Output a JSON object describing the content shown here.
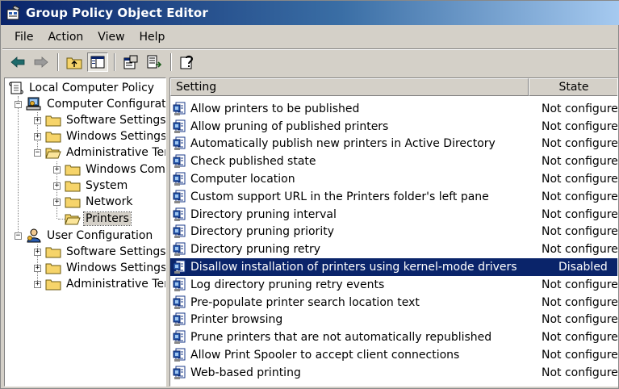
{
  "window": {
    "title": "Group Policy Object Editor"
  },
  "menu": [
    "File",
    "Action",
    "View",
    "Help"
  ],
  "toolbar": {
    "buttons": [
      "back-icon",
      "forward-icon",
      "up-folder-icon",
      "show-hide-tree-icon",
      "properties-icon",
      "export-list-icon",
      "help-icon"
    ]
  },
  "tree": {
    "root": "Local Computer Policy",
    "computer": "Computer Configuration",
    "software_settings": "Software Settings",
    "windows_settings": "Windows Settings",
    "administrative_templates": "Administrative Templates",
    "windows_components": "Windows Components",
    "system": "System",
    "network": "Network",
    "printers": "Printers",
    "user": "User Configuration",
    "user_software_settings": "Software Settings",
    "user_windows_settings": "Windows Settings",
    "user_administrative_templates": "Administrative Templates"
  },
  "list": {
    "columns": {
      "setting": "Setting",
      "state": "State"
    },
    "rows": [
      {
        "setting": "Allow printers to be published",
        "state": "Not configured"
      },
      {
        "setting": "Allow pruning of published printers",
        "state": "Not configured"
      },
      {
        "setting": "Automatically publish new printers in Active Directory",
        "state": "Not configured"
      },
      {
        "setting": "Check published state",
        "state": "Not configured"
      },
      {
        "setting": "Computer location",
        "state": "Not configured"
      },
      {
        "setting": "Custom support URL in the Printers folder's left pane",
        "state": "Not configured"
      },
      {
        "setting": "Directory pruning interval",
        "state": "Not configured"
      },
      {
        "setting": "Directory pruning priority",
        "state": "Not configured"
      },
      {
        "setting": "Directory pruning retry",
        "state": "Not configured"
      },
      {
        "setting": "Disallow installation of printers using kernel-mode drivers",
        "state": "Disabled",
        "selected": true
      },
      {
        "setting": "Log directory pruning retry events",
        "state": "Not configured"
      },
      {
        "setting": "Pre-populate printer search location text",
        "state": "Not configured"
      },
      {
        "setting": "Printer browsing",
        "state": "Not configured"
      },
      {
        "setting": "Prune printers that are not automatically republished",
        "state": "Not configured"
      },
      {
        "setting": "Allow Print Spooler to accept client connections",
        "state": "Not configured"
      },
      {
        "setting": "Web-based printing",
        "state": "Not configured"
      }
    ]
  },
  "colors": {
    "title_start": "#0a246a",
    "title_end": "#a6caf0",
    "selection": "#0a246a",
    "chrome": "#d4d0c8"
  }
}
